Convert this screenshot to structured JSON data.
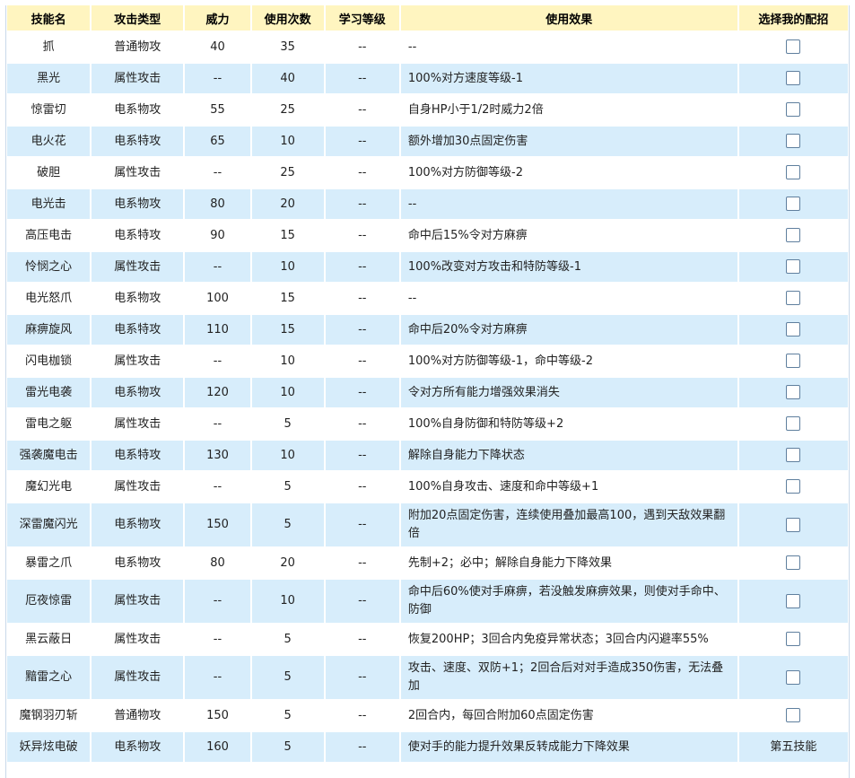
{
  "headers": [
    "技能名",
    "攻击类型",
    "威力",
    "使用次数",
    "学习等级",
    "使用效果",
    "选择我的配招"
  ],
  "rows": [
    {
      "name": "抓",
      "type": "普通物攻",
      "power": "40",
      "pp": "35",
      "level": "--",
      "effect": "--",
      "select": "checkbox"
    },
    {
      "name": "黑光",
      "type": "属性攻击",
      "power": "--",
      "pp": "40",
      "level": "--",
      "effect": "100%对方速度等级-1",
      "select": "checkbox"
    },
    {
      "name": "惊雷切",
      "type": "电系物攻",
      "power": "55",
      "pp": "25",
      "level": "--",
      "effect": "自身HP小于1/2时威力2倍",
      "select": "checkbox"
    },
    {
      "name": "电火花",
      "type": "电系特攻",
      "power": "65",
      "pp": "10",
      "level": "--",
      "effect": "额外增加30点固定伤害",
      "select": "checkbox"
    },
    {
      "name": "破胆",
      "type": "属性攻击",
      "power": "--",
      "pp": "25",
      "level": "--",
      "effect": "100%对方防御等级-2",
      "select": "checkbox"
    },
    {
      "name": "电光击",
      "type": "电系物攻",
      "power": "80",
      "pp": "20",
      "level": "--",
      "effect": "--",
      "select": "checkbox"
    },
    {
      "name": "高压电击",
      "type": "电系特攻",
      "power": "90",
      "pp": "15",
      "level": "--",
      "effect": "命中后15%令对方麻痹",
      "select": "checkbox"
    },
    {
      "name": "怜悯之心",
      "type": "属性攻击",
      "power": "--",
      "pp": "10",
      "level": "--",
      "effect": "100%改变对方攻击和特防等级-1",
      "select": "checkbox"
    },
    {
      "name": "电光怒爪",
      "type": "电系物攻",
      "power": "100",
      "pp": "15",
      "level": "--",
      "effect": "--",
      "select": "checkbox"
    },
    {
      "name": "麻痹旋风",
      "type": "电系特攻",
      "power": "110",
      "pp": "15",
      "level": "--",
      "effect": "命中后20%令对方麻痹",
      "select": "checkbox"
    },
    {
      "name": "闪电枷锁",
      "type": "属性攻击",
      "power": "--",
      "pp": "10",
      "level": "--",
      "effect": "100%对方防御等级-1，命中等级-2",
      "select": "checkbox"
    },
    {
      "name": "雷光电袭",
      "type": "电系物攻",
      "power": "120",
      "pp": "10",
      "level": "--",
      "effect": "令对方所有能力增强效果消失",
      "select": "checkbox"
    },
    {
      "name": "雷电之躯",
      "type": "属性攻击",
      "power": "--",
      "pp": "5",
      "level": "--",
      "effect": "100%自身防御和特防等级+2",
      "select": "checkbox"
    },
    {
      "name": "强袭魔电击",
      "type": "电系特攻",
      "power": "130",
      "pp": "10",
      "level": "--",
      "effect": "解除自身能力下降状态",
      "select": "checkbox"
    },
    {
      "name": "魔幻光电",
      "type": "属性攻击",
      "power": "--",
      "pp": "5",
      "level": "--",
      "effect": "100%自身攻击、速度和命中等级+1",
      "select": "checkbox"
    },
    {
      "name": "深雷魔闪光",
      "type": "电系物攻",
      "power": "150",
      "pp": "5",
      "level": "--",
      "effect": "附加20点固定伤害，连续使用叠加最高100，遇到天敌效果翻倍",
      "select": "checkbox",
      "tall": true
    },
    {
      "name": "暴雷之爪",
      "type": "电系物攻",
      "power": "80",
      "pp": "20",
      "level": "--",
      "effect": "先制+2；必中；解除自身能力下降效果",
      "select": "checkbox"
    },
    {
      "name": "厄夜惊雷",
      "type": "属性攻击",
      "power": "--",
      "pp": "10",
      "level": "--",
      "effect": "命中后60%使对手麻痹，若没触发麻痹效果，则使对手命中、防御",
      "select": "checkbox",
      "tall": true
    },
    {
      "name": "黑云蔽日",
      "type": "属性攻击",
      "power": "--",
      "pp": "5",
      "level": "--",
      "effect": "恢复200HP；3回合内免疫异常状态；3回合内闪避率55%",
      "select": "checkbox"
    },
    {
      "name": "黯雷之心",
      "type": "属性攻击",
      "power": "--",
      "pp": "5",
      "level": "--",
      "effect": "攻击、速度、双防+1；2回合后对对手造成350伤害，无法叠加",
      "select": "checkbox",
      "tall": true
    },
    {
      "name": "魔钢羽刃斩",
      "type": "普通物攻",
      "power": "150",
      "pp": "5",
      "level": "--",
      "effect": "2回合内，每回合附加60点固定伤害",
      "select": "checkbox"
    },
    {
      "name": "妖异炫电破",
      "type": "电系物攻",
      "power": "160",
      "pp": "5",
      "level": "--",
      "effect": "使对手的能力提升效果反转成能力下降效果",
      "select": "第五技能"
    }
  ]
}
